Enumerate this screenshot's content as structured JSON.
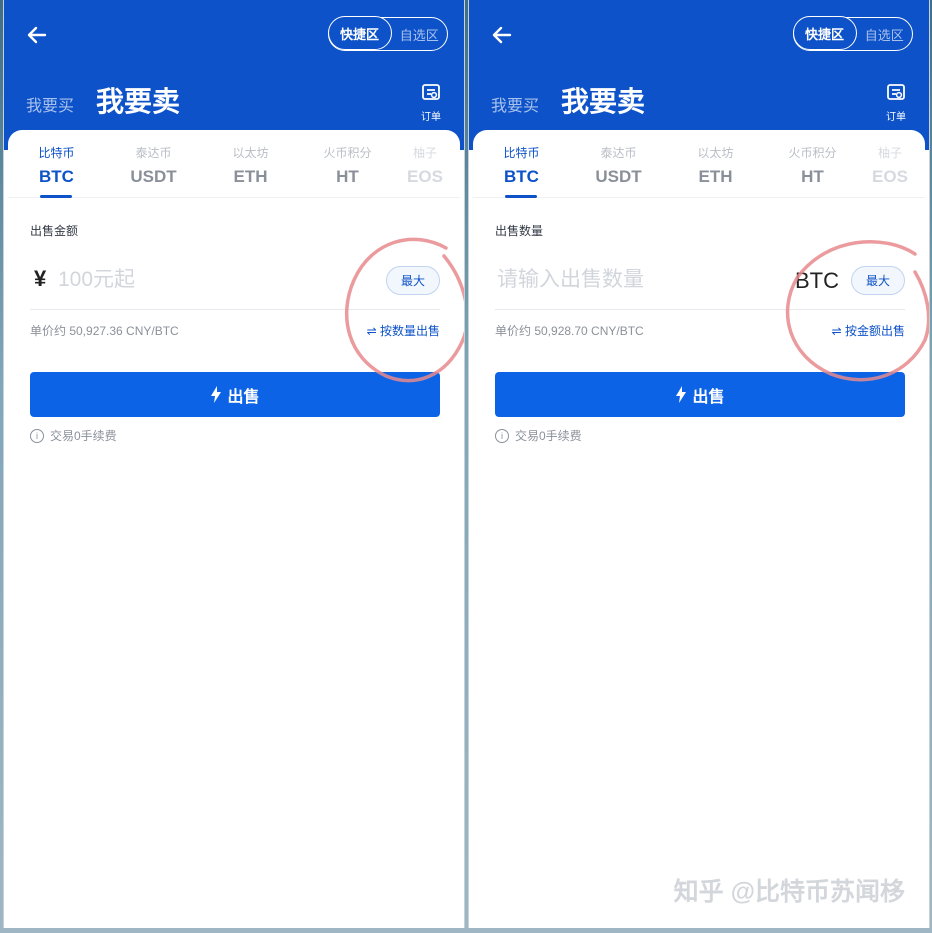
{
  "screens": [
    {
      "header": {
        "quick_zone": "快捷区",
        "select_zone": "自选区",
        "buy_tab": "我要买",
        "sell_title": "我要卖",
        "orders_label": "订单"
      },
      "coins": [
        {
          "cn": "比特币",
          "sym": "BTC"
        },
        {
          "cn": "泰达币",
          "sym": "USDT"
        },
        {
          "cn": "以太坊",
          "sym": "ETH"
        },
        {
          "cn": "火币积分",
          "sym": "HT"
        },
        {
          "cn": "柚子",
          "sym": "EOS"
        }
      ],
      "active_coin": "BTC",
      "field_label": "出售金额",
      "currency_symbol": "¥",
      "input_placeholder": "100元起",
      "max_label": "最大",
      "unit_price": "单价约 50,927.36 CNY/BTC",
      "switch_label": "按数量出售",
      "sell_button": "出售",
      "fee_note": "交易0手续费"
    },
    {
      "header": {
        "quick_zone": "快捷区",
        "select_zone": "自选区",
        "buy_tab": "我要买",
        "sell_title": "我要卖",
        "orders_label": "订单"
      },
      "coins": [
        {
          "cn": "比特币",
          "sym": "BTC"
        },
        {
          "cn": "泰达币",
          "sym": "USDT"
        },
        {
          "cn": "以太坊",
          "sym": "ETH"
        },
        {
          "cn": "火币积分",
          "sym": "HT"
        },
        {
          "cn": "柚子",
          "sym": "EOS"
        }
      ],
      "active_coin": "BTC",
      "field_label": "出售数量",
      "input_placeholder": "请输入出售数量",
      "unit_text": "BTC",
      "max_label": "最大",
      "unit_price": "单价约 50,928.70 CNY/BTC",
      "switch_label": "按金额出售",
      "sell_button": "出售",
      "fee_note": "交易0手续费"
    }
  ],
  "watermark": "知乎 @比特币苏闻栘",
  "colors": {
    "brand_blue": "#0d52c8",
    "button_blue": "#0d63e6",
    "annotation_red": "#e8898c"
  }
}
